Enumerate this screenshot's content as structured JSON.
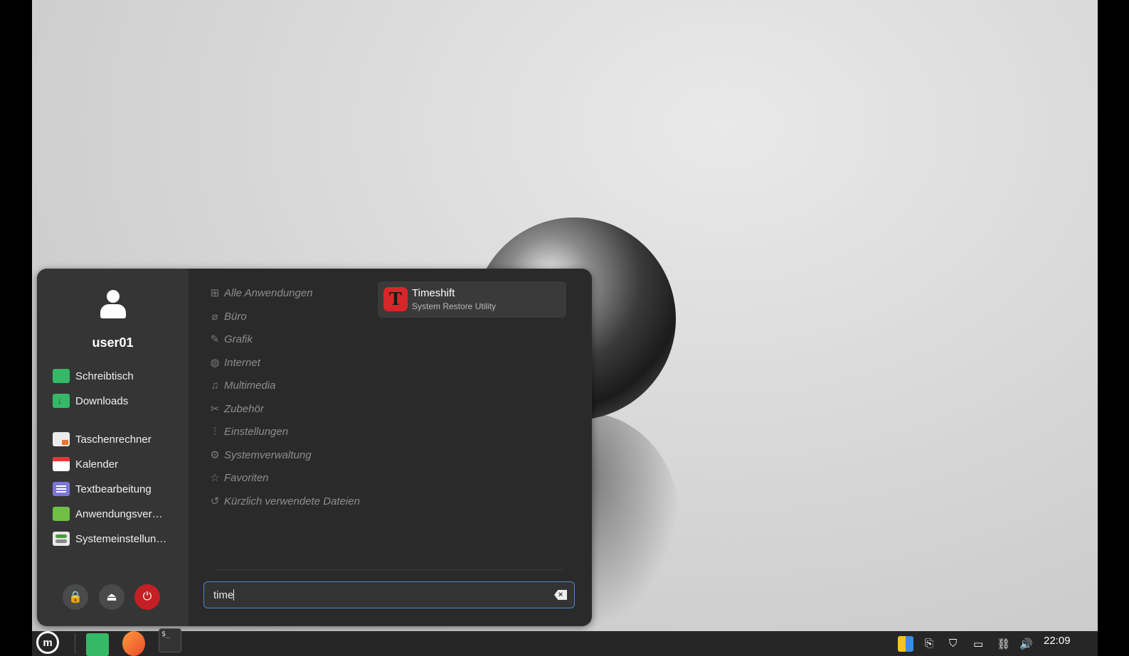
{
  "menu": {
    "username": "user01",
    "places": [
      {
        "label": "Schreibtisch",
        "icon": "desktop-folder-icon"
      },
      {
        "label": "Downloads",
        "icon": "downloads-folder-icon"
      }
    ],
    "favorites": [
      {
        "label": "Taschenrechner",
        "icon": "calculator-icon"
      },
      {
        "label": "Kalender",
        "icon": "calendar-icon"
      },
      {
        "label": "Textbearbeitung",
        "icon": "text-editor-icon"
      },
      {
        "label": "Anwendungsver…",
        "icon": "software-manager-icon"
      },
      {
        "label": "Systemeinstellun…",
        "icon": "system-settings-icon"
      }
    ],
    "categories": [
      {
        "label": "Alle Anwendungen",
        "icon": "⊞"
      },
      {
        "label": "Büro",
        "icon": "⌀"
      },
      {
        "label": "Grafik",
        "icon": "✎"
      },
      {
        "label": "Internet",
        "icon": "◍"
      },
      {
        "label": "Multimedia",
        "icon": "♫"
      },
      {
        "label": "Zubehör",
        "icon": "✂"
      },
      {
        "label": "Einstellungen",
        "icon": "⫶"
      },
      {
        "label": "Systemverwaltung",
        "icon": "⚙"
      },
      {
        "label": "Favoriten",
        "icon": "☆"
      },
      {
        "label": "Kürzlich verwendete Dateien",
        "icon": "↺"
      }
    ],
    "result": {
      "name": "Timeshift",
      "description": "System Restore Utility",
      "icon_letter": "T"
    },
    "search": {
      "value": "time"
    },
    "session_buttons": {
      "lock": "🔒",
      "logout": "⏏",
      "power": "⏻"
    }
  },
  "taskbar": {
    "menu_button": "m",
    "terminal_label": "$_",
    "clock": "22:09"
  },
  "colors": {
    "accent": "#4a87c9",
    "power": "#c41f24",
    "folder_green": "#35b966"
  }
}
